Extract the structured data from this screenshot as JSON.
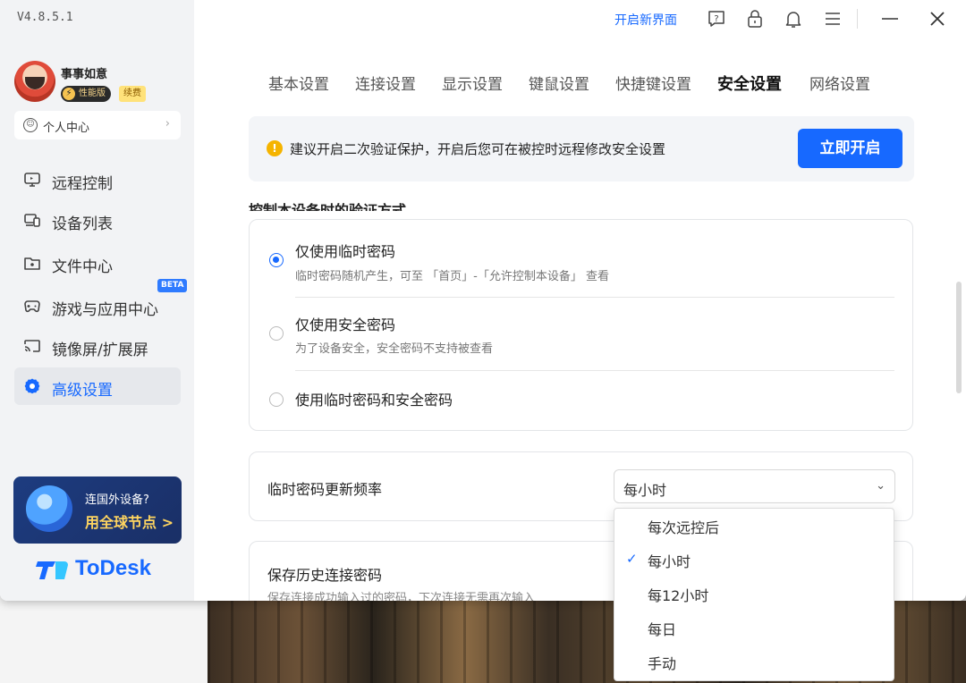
{
  "app": {
    "version": "V4.8.5.1",
    "brand": "ToDesk",
    "accent": "#1769ff"
  },
  "user": {
    "name": "事事如意",
    "tier_badge": "性能版",
    "renew_badge": "续费",
    "personal_center": "个人中心"
  },
  "sidebar": {
    "items": [
      {
        "label": "远程控制",
        "icon": "monitor-icon"
      },
      {
        "label": "设备列表",
        "icon": "devices-icon"
      },
      {
        "label": "文件中心",
        "icon": "folder-icon"
      },
      {
        "label": "游戏与应用中心",
        "icon": "gamepad-icon",
        "badge": "BETA"
      },
      {
        "label": "镜像屏/扩展屏",
        "icon": "cast-icon"
      },
      {
        "label": "高级设置",
        "icon": "gear-icon",
        "active": true
      }
    ],
    "promo": {
      "line1": "连国外设备?",
      "line2": "用全球节点 >"
    }
  },
  "topbar": {
    "new_ui_link": "开启新界面"
  },
  "tabs": [
    {
      "label": "基本设置"
    },
    {
      "label": "连接设置"
    },
    {
      "label": "显示设置"
    },
    {
      "label": "键鼠设置"
    },
    {
      "label": "快捷键设置"
    },
    {
      "label": "安全设置",
      "active": true
    },
    {
      "label": "网络设置"
    }
  ],
  "notice": {
    "text": "建议开启二次验证保护，开启后您可在被控时远程修改安全设置",
    "button": "立即开启"
  },
  "auth": {
    "section_title": "控制本设备时的验证方式",
    "options": [
      {
        "label": "仅使用临时密码",
        "sub": "临时密码随机产生，可至 「首页」-「允许控制本设备」 查看",
        "checked": true
      },
      {
        "label": "仅使用安全密码",
        "sub": "为了设备安全，安全密码不支持被查看",
        "checked": false
      },
      {
        "label": "使用临时密码和安全密码",
        "sub": "",
        "checked": false
      }
    ]
  },
  "frequency": {
    "label": "临时密码更新频率",
    "selected": "每小时",
    "options": [
      "每次远控后",
      "每小时",
      "每12小时",
      "每日",
      "手动"
    ]
  },
  "history": {
    "label": "保存历史连接密码",
    "sub": "保存连接成功输入过的密码，下次连接无需再次输入"
  }
}
